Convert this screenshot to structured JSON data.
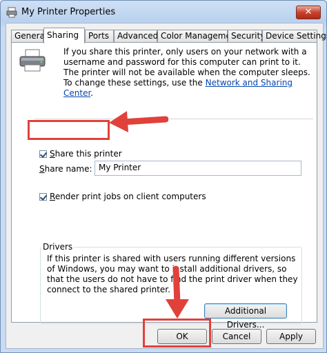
{
  "window": {
    "title": "My Printer Properties",
    "close_label": "✕"
  },
  "tabs": [
    {
      "label": "General",
      "active": false
    },
    {
      "label": "Sharing",
      "active": true
    },
    {
      "label": "Ports",
      "active": false
    },
    {
      "label": "Advanced",
      "active": false
    },
    {
      "label": "Color Management",
      "active": false
    },
    {
      "label": "Security",
      "active": false
    },
    {
      "label": "Device Settings",
      "active": false
    }
  ],
  "sharing": {
    "info_text": "If you share this printer, only users on your network with a username and password for this computer can print to it. The printer will not be available when the computer sleeps. To change these settings, use the ",
    "info_link": "Network and Sharing Center",
    "info_end": ".",
    "share_checkbox_label": "Share this printer",
    "share_name_label": "Share name:",
    "share_name_value": "My Printer",
    "render_checkbox_label": "Render print jobs on client computers",
    "drivers_group_label": "Drivers",
    "drivers_text": "If this printer is shared with users running different versions of Windows, you may want to install additional drivers, so that the users do not have to find the print driver when they connect to the shared printer.",
    "additional_drivers_label": "Additional Drivers..."
  },
  "footer": {
    "ok_label": "OK",
    "cancel_label": "Cancel",
    "apply_label": "Apply"
  },
  "annotation_color": "#e0413a"
}
